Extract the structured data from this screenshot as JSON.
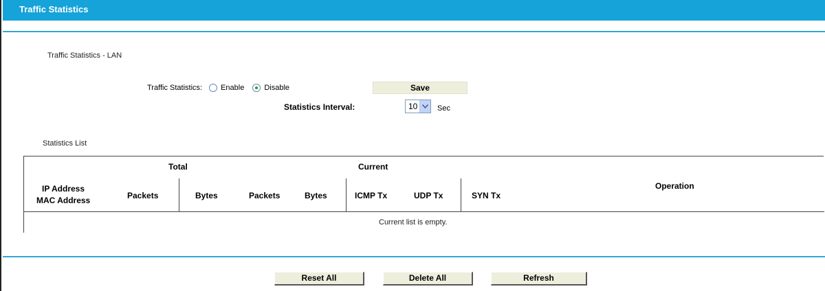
{
  "header": {
    "title": "Traffic Statistics"
  },
  "lan": {
    "section_title": "Traffic Statistics - LAN",
    "status_label": "Traffic Statistics:",
    "enable_label": "Enable",
    "disable_label": "Disable",
    "selected": "disable",
    "save_label": "Save",
    "interval_label": "Statistics Interval:",
    "interval_value": "10",
    "interval_unit": "Sec"
  },
  "list": {
    "section_title": "Statistics List",
    "group_headers": {
      "total": "Total",
      "current": "Current"
    },
    "columns": {
      "ip": "IP Address",
      "mac": "MAC Address",
      "total_packets": "Packets",
      "total_bytes": "Bytes",
      "current_packets": "Packets",
      "current_bytes": "Bytes",
      "icmp_tx": "ICMP Tx",
      "udp_tx": "UDP Tx",
      "syn_tx": "SYN Tx",
      "operation": "Operation"
    },
    "empty_message": "Current list is empty."
  },
  "buttons": {
    "reset_all": "Reset All",
    "delete_all": "Delete All",
    "refresh": "Refresh"
  },
  "colors": {
    "title_bar": "#15a3da",
    "divider": "#31a6d8",
    "button_bg": "#eeeedd"
  }
}
